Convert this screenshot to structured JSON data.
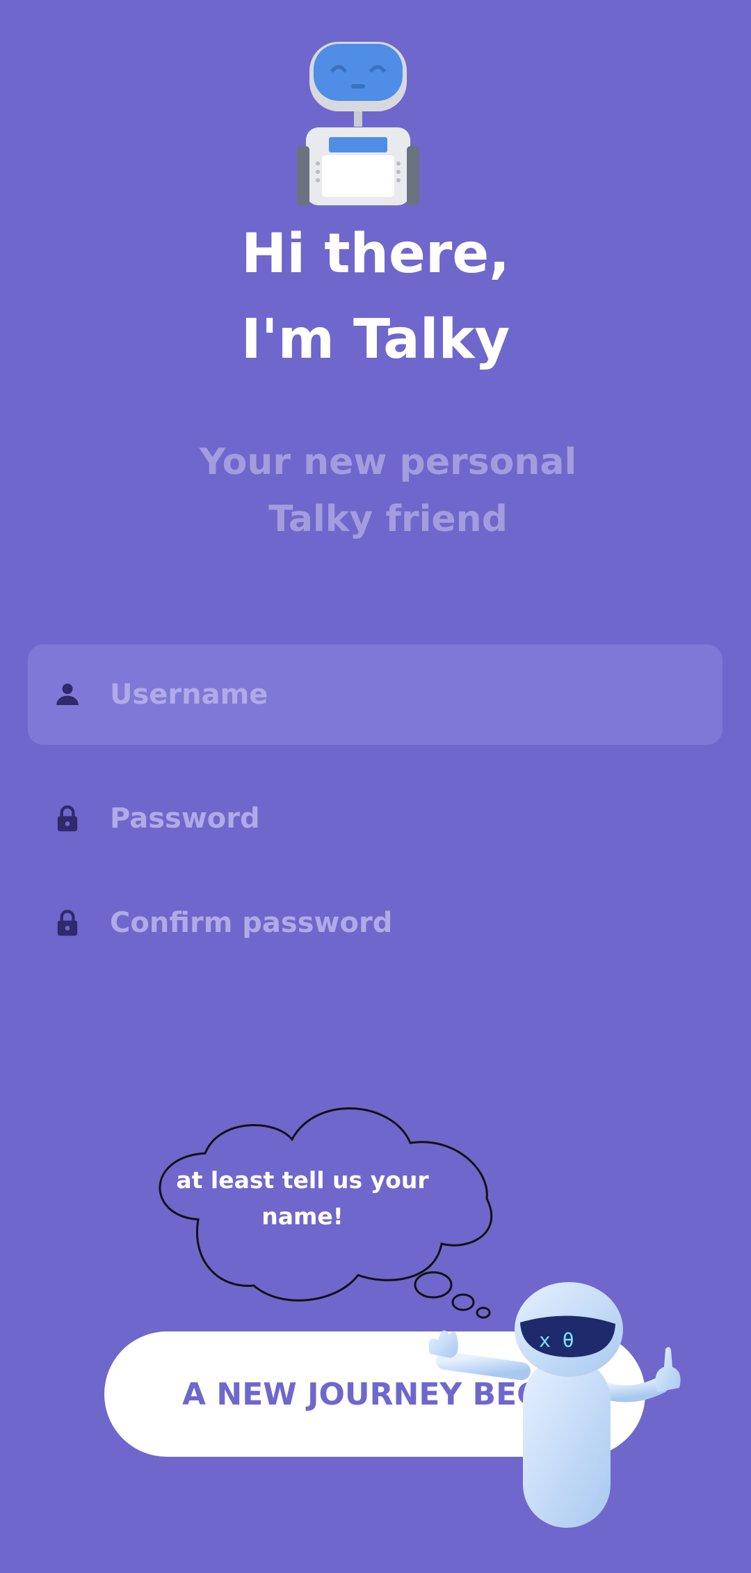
{
  "header": {
    "title_line1": "Hi there,",
    "title_line2": "I'm Talky",
    "subtitle_line1": "Your new personal",
    "subtitle_line2": "Talky friend"
  },
  "form": {
    "username": {
      "placeholder": "Username",
      "icon": "person-icon"
    },
    "password": {
      "placeholder": "Password",
      "icon": "lock-icon"
    },
    "confirm_password": {
      "placeholder": "Confirm password",
      "icon": "lock-icon"
    }
  },
  "hint": {
    "line1": "at least tell us your",
    "line2": "name!"
  },
  "cta": {
    "label": "A NEW JOURNEY BEGINS"
  },
  "colors": {
    "background": "#6f67cc",
    "field_active": "#8078d6",
    "placeholder": "#b0abe6",
    "icon": "#2f2a6b",
    "button_bg": "#ffffff",
    "button_text": "#6f67cc"
  }
}
